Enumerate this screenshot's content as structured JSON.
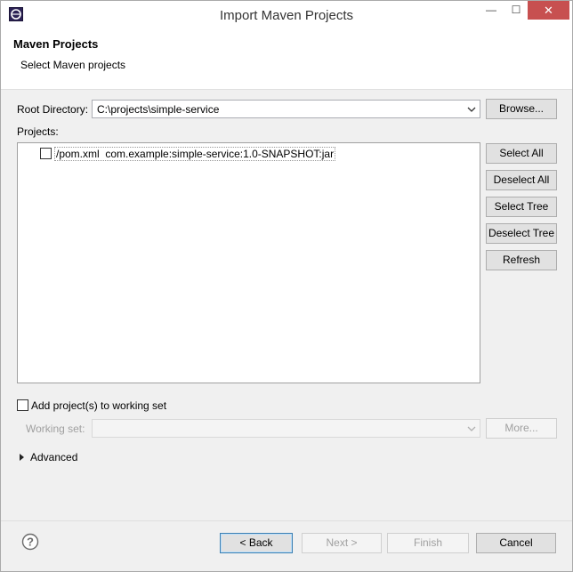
{
  "window": {
    "title": "Import Maven Projects"
  },
  "controls": {
    "minimize": "—",
    "maximize": "☐",
    "close": "✕"
  },
  "header": {
    "title": "Maven Projects",
    "description": "Select Maven projects"
  },
  "root": {
    "label": "Root Directory:",
    "value": "C:\\projects\\simple-service",
    "browse": "Browse..."
  },
  "projects": {
    "label": "Projects:",
    "items": [
      {
        "path": "/pom.xml",
        "artifact": "com.example:simple-service:1.0-SNAPSHOT:jar",
        "checked": false
      }
    ]
  },
  "sidebuttons": {
    "select_all": "Select All",
    "deselect_all": "Deselect All",
    "select_tree": "Select Tree",
    "deselect_tree": "Deselect Tree",
    "refresh": "Refresh"
  },
  "workingset": {
    "checkbox_label": "Add project(s) to working set",
    "label": "Working set:",
    "value": "",
    "more": "More..."
  },
  "advanced": {
    "label": "Advanced"
  },
  "footer": {
    "back": "< Back",
    "next": "Next >",
    "finish": "Finish",
    "cancel": "Cancel"
  },
  "colors": {
    "close_button": "#c75050",
    "focus_border": "#3c7fb1"
  }
}
